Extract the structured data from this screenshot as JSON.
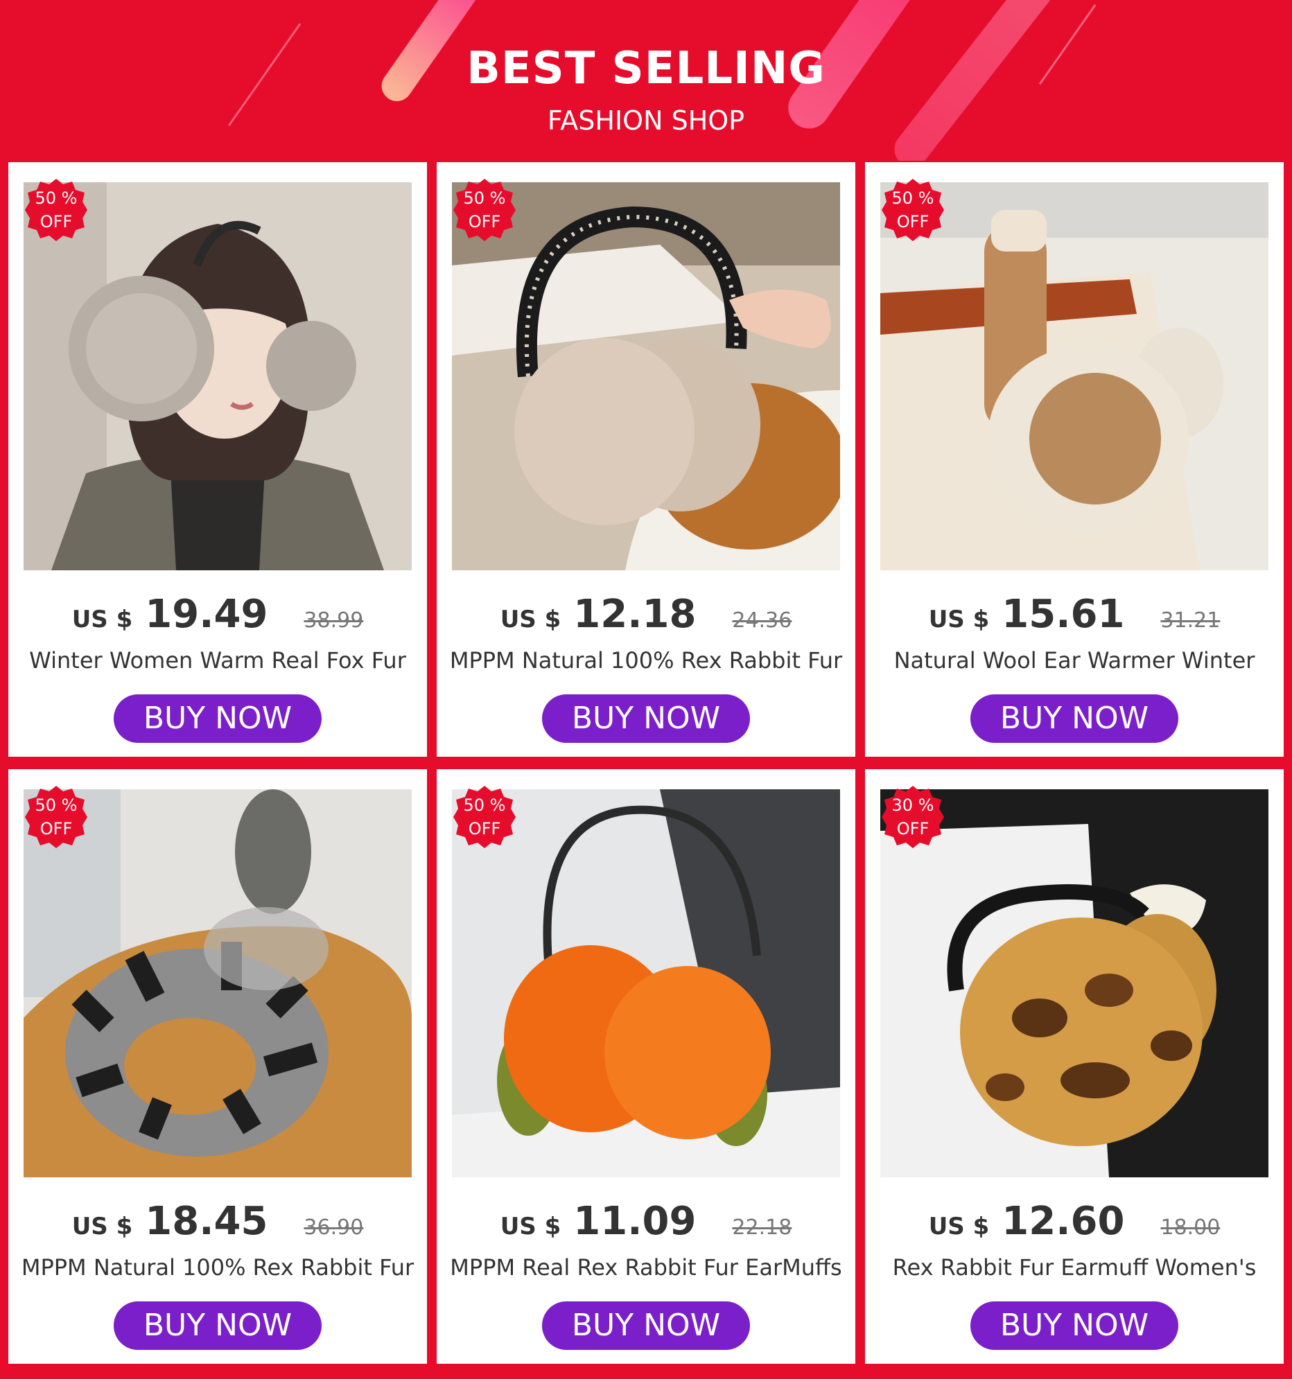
{
  "header": {
    "title": "BEST SELLING",
    "subtitle": "FASHION SHOP"
  },
  "colors": {
    "background": "#e60c2c",
    "button": "#7a1fc9",
    "badge": "#e60c2c",
    "text": "#333333"
  },
  "products": [
    {
      "badge_line1": "50 %",
      "badge_line2": "OFF",
      "currency": "US $",
      "price": "19.49",
      "original_price": "38.99",
      "name": "Winter Women Warm Real Fox Fur",
      "button_label": "BUY NOW",
      "image_icon": "woman-wearing-fur-earmuffs"
    },
    {
      "badge_line1": "50 %",
      "badge_line2": "OFF",
      "currency": "US $",
      "price": "12.18",
      "original_price": "24.36",
      "name": "MPPM Natural 100% Rex Rabbit Fur",
      "button_label": "BUY NOW",
      "image_icon": "beige-rabbit-fur-earmuffs"
    },
    {
      "badge_line1": "50 %",
      "badge_line2": "OFF",
      "currency": "US $",
      "price": "15.61",
      "original_price": "31.21",
      "name": "Natural Wool Ear Warmer Winter",
      "button_label": "BUY NOW",
      "image_icon": "wool-ear-warmer"
    },
    {
      "badge_line1": "50 %",
      "badge_line2": "OFF",
      "currency": "US $",
      "price": "18.45",
      "original_price": "36.90",
      "name": "MPPM Natural 100% Rex Rabbit Fur",
      "button_label": "BUY NOW",
      "image_icon": "grey-striped-fur-earmuffs"
    },
    {
      "badge_line1": "50 %",
      "badge_line2": "OFF",
      "currency": "US $",
      "price": "11.09",
      "original_price": "22.18",
      "name": "MPPM Real Rex Rabbit Fur EarMuffs",
      "button_label": "BUY NOW",
      "image_icon": "orange-fur-earmuffs"
    },
    {
      "badge_line1": "30 %",
      "badge_line2": "OFF",
      "currency": "US $",
      "price": "12.60",
      "original_price": "18.00",
      "name": "Rex Rabbit Fur Earmuff Women's",
      "button_label": "BUY NOW",
      "image_icon": "leopard-fur-earmuffs"
    }
  ]
}
